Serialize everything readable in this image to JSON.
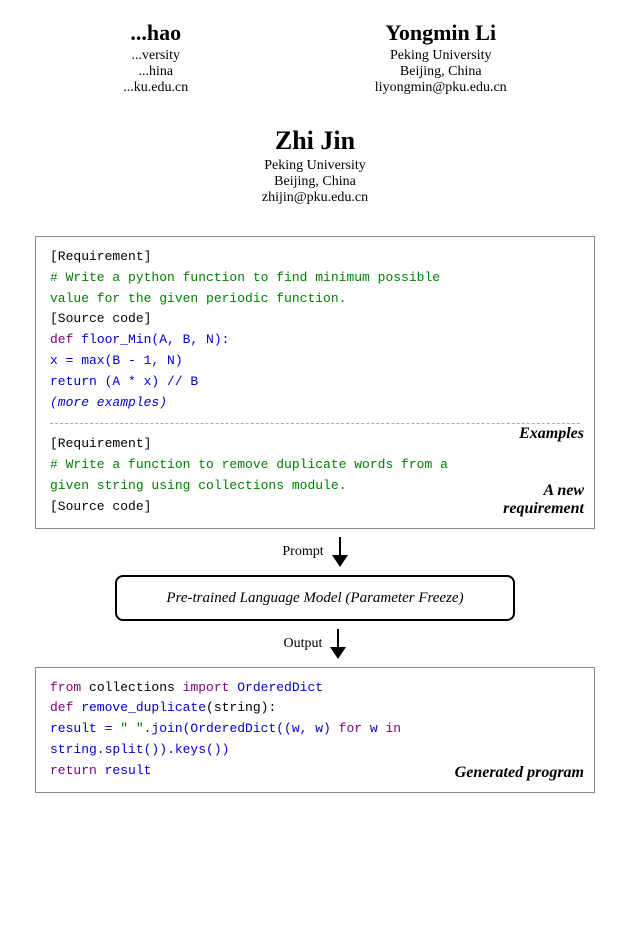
{
  "authors": {
    "left": {
      "name": "...hao",
      "affiliation1": "...versity",
      "affiliation2": "...hina",
      "email": "...ku.edu.cn"
    },
    "right": {
      "name": "Yongmin Li",
      "affiliation1": "Peking University",
      "affiliation2": "Beijing, China",
      "email": "liyongmin@pku.edu.cn"
    },
    "center": {
      "name": "Zhi Jin",
      "affiliation1": "Peking University",
      "affiliation2": "Beijing, China",
      "email": "zhijin@pku.edu.cn"
    }
  },
  "diagram": {
    "examples_label": "Examples",
    "new_req_label": "A new\nrequirement",
    "prompt_label": "Prompt",
    "output_label": "Output",
    "llm_label": "Pre-trained Language Model (Parameter Freeze)",
    "generated_label": "Generated program",
    "example1": {
      "req_tag": "[Requirement]",
      "req_comment": "# Write a python function to find minimum possible",
      "req_comment2": "value for the given periodic function.",
      "src_tag": "[Source code]",
      "line1": "def floor_Min(A, B, N):",
      "line2": "    x = max(B - 1, N)",
      "line3": "    return (A * x) // B",
      "line4": "        (more examples)"
    },
    "example2": {
      "req_tag": "[Requirement]",
      "req_comment": "# Write a function to remove duplicate words from a",
      "req_comment2": "given string using collections module.",
      "src_tag": "[Source code]"
    },
    "output_code": {
      "line1_kw": "from",
      "line1_plain": " collections ",
      "line1_kw2": "import",
      "line1_id": " OrderedDict",
      "line2_kw": "def",
      "line2_id": " remove_duplicate",
      "line2_plain": "(string):",
      "line3_plain": "    result = ",
      "line3_str": "\" \"",
      "line3_plain2": ".join(OrderedDict((w, w) ",
      "line3_kw": "for",
      "line3_plain3": " w ",
      "line3_kw2": "in",
      "line4_plain": "    string.split()).keys())",
      "line5_kw": "    return",
      "line5_id": " result"
    }
  }
}
